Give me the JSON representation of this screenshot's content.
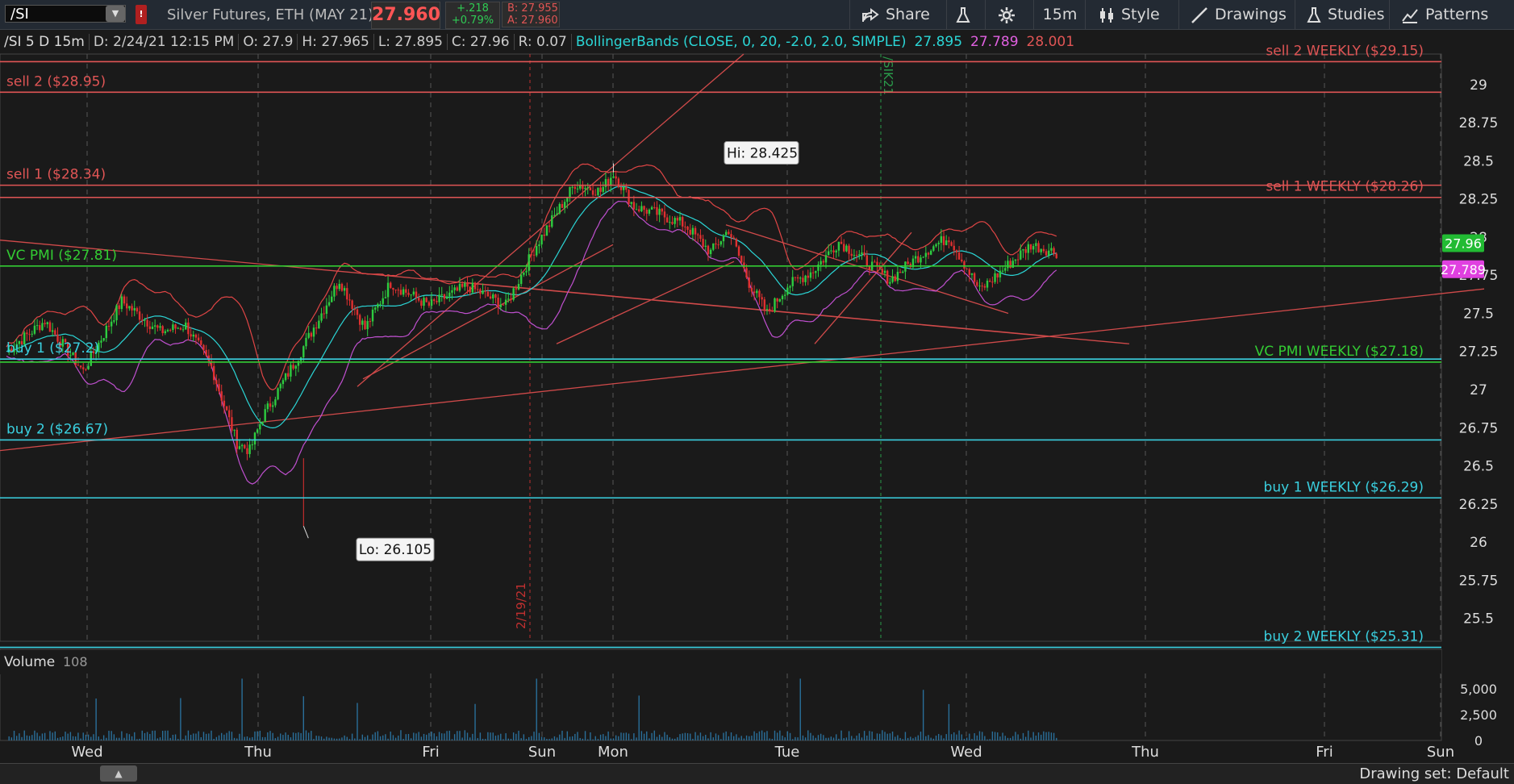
{
  "toolbar": {
    "symbol": "/SI",
    "alert_flag": "!",
    "description": "Silver Futures, ETH (MAY 21)",
    "last_price": "27.960",
    "net_change": "+.218",
    "pct_change": "+0.79%",
    "bid": "B: 27.955",
    "ask": "A: 27.960",
    "share_label": "Share",
    "timeframe_label": "15m",
    "style_label": "Style",
    "drawings_label": "Drawings",
    "studies_label": "Studies",
    "patterns_label": "Patterns"
  },
  "info": {
    "symbol_period": "/SI 5 D 15m",
    "date": "D: 2/24/21 12:15 PM",
    "open": "O: 27.9",
    "high": "H: 27.965",
    "low": "L: 27.895",
    "close": "C: 27.96",
    "range": "R: 0.07",
    "study": "BollingerBands (CLOSE, 0, 20, -2.0, 2.0, SIMPLE)",
    "bb_mid": "27.895",
    "bb_lower": "27.789",
    "bb_upper": "28.001"
  },
  "volume_panel": {
    "label": "Volume",
    "value": "108"
  },
  "status": {
    "drawing_set": "Drawing set: Default"
  },
  "colors": {
    "up": "#2ecc40",
    "down": "#e03030",
    "mid": "#2bd6d6",
    "upper": "#e04545",
    "lower": "#c050d0",
    "sell": "#e05555",
    "buy": "#3ad0e0",
    "pmi": "#33cc33"
  },
  "chart_data": {
    "type": "candlestick",
    "x_labels": [
      "Wed",
      "Thu",
      "Fri",
      "Sun",
      "Mon",
      "Tue",
      "Wed",
      "Thu",
      "Fri",
      "Sun"
    ],
    "y_ticks": [
      "29",
      "28.75",
      "28.5",
      "28.25",
      "28",
      "27.75",
      "27.5",
      "27.25",
      "27",
      "26.75",
      "26.5",
      "26.25",
      "26",
      "25.75",
      "25.5"
    ],
    "ylim": [
      25.35,
      29.2
    ],
    "price_badges": [
      {
        "text": "27.96",
        "value": 27.96,
        "color": "#22bb33"
      },
      {
        "text": "27.789",
        "value": 27.789,
        "color": "#e040e0"
      }
    ],
    "levels": [
      {
        "label": "sell 2 WEEKLY ($29.15)",
        "value": 29.15,
        "color": "#e05555",
        "side": "right"
      },
      {
        "label": "sell 2 ($28.95)",
        "value": 28.95,
        "color": "#e05555",
        "side": "left"
      },
      {
        "label": "sell 1 ($28.34)",
        "value": 28.34,
        "color": "#e05555",
        "side": "left"
      },
      {
        "label": "sell 1 WEEKLY ($28.26)",
        "value": 28.26,
        "color": "#e05555",
        "side": "right"
      },
      {
        "label": "VC PMI ($27.81)",
        "value": 27.81,
        "color": "#33cc33",
        "side": "left"
      },
      {
        "label": "buy 1 ($27.2)",
        "value": 27.2,
        "color": "#3ad0e0",
        "side": "left"
      },
      {
        "label": "VC PMI WEEKLY ($27.18)",
        "value": 27.18,
        "color": "#33cc33",
        "side": "right"
      },
      {
        "label": "buy 2 ($26.67)",
        "value": 26.67,
        "color": "#3ad0e0",
        "side": "left"
      },
      {
        "label": "buy 1 WEEKLY ($26.29)",
        "value": 26.29,
        "color": "#3ad0e0",
        "side": "right"
      },
      {
        "label": "buy 2 WEEKLY ($25.31)",
        "value": 25.31,
        "color": "#3ad0e0",
        "side": "right"
      }
    ],
    "callouts": [
      {
        "text": "Hi: 28.425",
        "value": 28.425
      },
      {
        "text": "Lo: 26.105",
        "value": 26.105
      }
    ],
    "vertical_markers": [
      {
        "text": "2/19/21",
        "color": "#c03030"
      },
      {
        "text": "/SIK21",
        "color": "#2a9a4a"
      }
    ],
    "volume_ticks": [
      "5,000",
      "2,500",
      "0"
    ],
    "volume_max": 6500,
    "price_path": [
      [
        0,
        27.25
      ],
      [
        15,
        27.45
      ],
      [
        30,
        27.12
      ],
      [
        45,
        27.58
      ],
      [
        60,
        27.38
      ],
      [
        70,
        27.42
      ],
      [
        80,
        27.15
      ],
      [
        90,
        26.65
      ],
      [
        95,
        26.6
      ],
      [
        100,
        26.82
      ],
      [
        115,
        27.25
      ],
      [
        130,
        27.72
      ],
      [
        140,
        27.4
      ],
      [
        150,
        27.7
      ],
      [
        165,
        27.55
      ],
      [
        180,
        27.68
      ],
      [
        195,
        27.55
      ],
      [
        207,
        27.95
      ],
      [
        222,
        28.35
      ],
      [
        232,
        28.3
      ],
      [
        237,
        28.42
      ],
      [
        245,
        28.2
      ],
      [
        255,
        28.15
      ],
      [
        265,
        28.08
      ],
      [
        275,
        27.9
      ],
      [
        282,
        28.05
      ],
      [
        290,
        27.7
      ],
      [
        297,
        27.5
      ],
      [
        305,
        27.68
      ],
      [
        315,
        27.78
      ],
      [
        325,
        27.97
      ],
      [
        335,
        27.85
      ],
      [
        345,
        27.72
      ],
      [
        358,
        27.9
      ],
      [
        368,
        28.0
      ],
      [
        380,
        27.65
      ],
      [
        390,
        27.8
      ],
      [
        400,
        27.95
      ],
      [
        410,
        27.9
      ]
    ]
  }
}
